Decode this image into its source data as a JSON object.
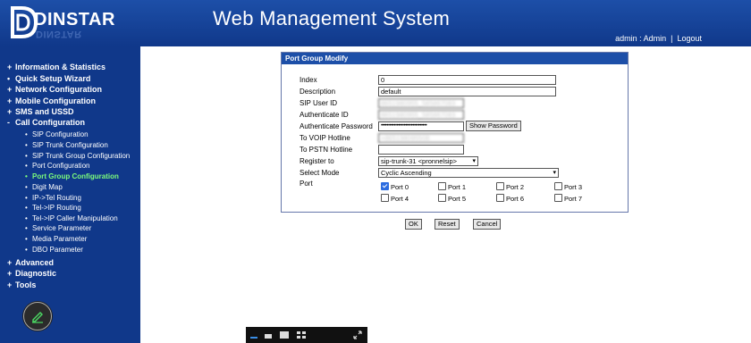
{
  "header": {
    "logo_text": "DINSTAR",
    "logo_mirror_text": "DINSTAR",
    "title": "Web Management System",
    "user_text": "admin : Admin",
    "logout_label": "Logout",
    "separator": "|"
  },
  "sidebar": {
    "sections": [
      {
        "mark": "+",
        "label": "Information & Statistics"
      },
      {
        "mark": "•",
        "label": "Quick Setup Wizard"
      },
      {
        "mark": "+",
        "label": "Network Configuration"
      },
      {
        "mark": "+",
        "label": "Mobile Configuration"
      },
      {
        "mark": "+",
        "label": "SMS and USSD"
      },
      {
        "mark": "-",
        "label": "Call Configuration"
      },
      {
        "mark": "+",
        "label": "Advanced"
      },
      {
        "mark": "+",
        "label": "Diagnostic"
      },
      {
        "mark": "+",
        "label": "Tools"
      }
    ],
    "call_items": [
      {
        "label": "SIP Configuration"
      },
      {
        "label": "SIP Trunk Configuration"
      },
      {
        "label": "SIP Trunk Group Configuration"
      },
      {
        "label": "Port Configuration"
      },
      {
        "label": "Port Group Configuration",
        "active": true
      },
      {
        "label": "Digit Map"
      },
      {
        "label": "IP->Tel Routing"
      },
      {
        "label": "Tel->IP Routing"
      },
      {
        "label": "Tel->IP Caller Manipulation"
      },
      {
        "label": "Service Parameter"
      },
      {
        "label": "Media Parameter"
      },
      {
        "label": "DBO Parameter"
      }
    ]
  },
  "panel": {
    "title": "Port Group Modify",
    "labels": {
      "index": "Index",
      "description": "Description",
      "sip_user_id": "SIP User ID",
      "authenticate_id": "Authenticate ID",
      "authenticate_password": "Authenticate Password",
      "to_voip_hotline": "To VOIP Hotline",
      "to_pstn_hotline": "To PSTN Hotline",
      "register_to": "Register to",
      "select_mode": "Select Mode",
      "port": "Port"
    },
    "values": {
      "index": "0",
      "description": "default",
      "sip_user_id": "8651980955_585867083",
      "authenticate_id": "8651980955_585867083",
      "authenticate_password": "••••••••••••••••••••••••••••••••",
      "to_voip_hotline": "+865198095508",
      "to_pstn_hotline": "",
      "register_to": "sip-trunk-31 <pronnelsip>",
      "select_mode": "Cyclic Ascending"
    },
    "show_password_label": "Show Password",
    "ports": [
      {
        "label": "Port 0",
        "checked": true
      },
      {
        "label": "Port 1",
        "checked": false
      },
      {
        "label": "Port 2",
        "checked": false
      },
      {
        "label": "Port 3",
        "checked": false
      },
      {
        "label": "Port 4",
        "checked": false
      },
      {
        "label": "Port 5",
        "checked": false
      },
      {
        "label": "Port 6",
        "checked": false
      },
      {
        "label": "Port 7",
        "checked": false
      }
    ]
  },
  "actions": {
    "ok": "OK",
    "reset": "Reset",
    "cancel": "Cancel"
  },
  "icons": {
    "edit": "pencil-icon",
    "taskbar": [
      "minimize-icon",
      "window-icon",
      "screen-icon",
      "grid-icon",
      "fullscreen-icon"
    ]
  }
}
